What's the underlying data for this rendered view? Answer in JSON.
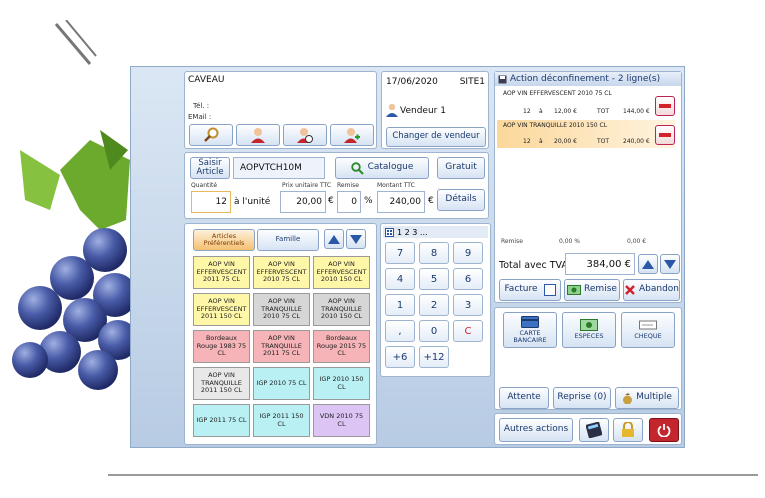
{
  "customer": {
    "name": "CAVEAU",
    "tel_label": "Tél. :",
    "email_label": "EMail :"
  },
  "session": {
    "date": "17/06/2020",
    "site": "SITE1",
    "vendor": "Vendeur 1",
    "change_vendor": "Changer de vendeur"
  },
  "article": {
    "saisir_label": "Saisir Article",
    "code": "AOPVTCH10M",
    "catalogue": "Catalogue",
    "gratuit": "Gratuit",
    "details": "Détails",
    "qty_label": "Quantité",
    "qty": "12",
    "unit": "à l'unité",
    "price_label": "Prix unitaire TTC",
    "price": "20,00",
    "currency": "€",
    "discount_label": "Remise",
    "discount": "0",
    "percent": "%",
    "amount_label": "Montant TTC",
    "amount": "240,00"
  },
  "browser": {
    "tab_favorites": "Articles Préférentiels",
    "tab_family": "Famille",
    "items": [
      {
        "label": "AOP VIN EFFERVESCENT 2011 75 CL",
        "color": "#fff7a8"
      },
      {
        "label": "AOP VIN EFFERVESCENT 2010 75 CL",
        "color": "#fff7a8"
      },
      {
        "label": "AOP VIN EFFERVESCENT 2010 150 CL",
        "color": "#fff7a8"
      },
      {
        "label": "AOP VIN EFFERVESCENT 2011 150 CL",
        "color": "#fff7a8"
      },
      {
        "label": "AOP VIN TRANQUILLE 2010 75 CL",
        "color": "#d6d6d6"
      },
      {
        "label": "AOP VIN TRANQUILLE 2010 150 CL",
        "color": "#d6d6d6"
      },
      {
        "label": "Bordeaux Rouge 1983 75 CL",
        "color": "#f6b4b8"
      },
      {
        "label": "AOP VIN TRANQUILLE 2011 75 CL",
        "color": "#f6b4b8"
      },
      {
        "label": "Bordeaux Rouge 2015 75 CL",
        "color": "#f6b4b8"
      },
      {
        "label": "AOP VIN TRANQUILLE 2011 150 CL",
        "color": "#e8e8e8"
      },
      {
        "label": "IGP 2010 75 CL",
        "color": "#b8f0f4"
      },
      {
        "label": "IGP 2010 150 CL",
        "color": "#b8f0f4"
      },
      {
        "label": "IGP 2011 75 CL",
        "color": "#b8f0f4"
      },
      {
        "label": "IGP 2011 150 CL",
        "color": "#b8f0f4"
      },
      {
        "label": "VDN 2010 75 CL",
        "color": "#dcc4f4"
      }
    ]
  },
  "keypad": {
    "display": "1 2 3 ...",
    "keys": [
      "7",
      "8",
      "9",
      "4",
      "5",
      "6",
      "1",
      "2",
      "3",
      ",",
      "0",
      "C",
      "+6",
      "+12"
    ]
  },
  "ticket": {
    "title": "Action déconfinement - 2 ligne(s)",
    "lines": [
      {
        "name": "AOP VIN EFFERVESCENT 2010 75 CL",
        "qty": "12",
        "at": "à",
        "price": "12,00 €",
        "tot_label": "TOT",
        "total": "144,00 €"
      },
      {
        "name": "AOP VIN TRANQUILLE 2010 150 CL",
        "qty": "12",
        "at": "à",
        "price": "20,00 €",
        "tot_label": "TOT",
        "total": "240,00 €"
      }
    ],
    "remise_label": "Remise",
    "remise_pct": "0,00 %",
    "remise_amount": "0,00 €",
    "total_label": "Total avec TVA",
    "total": "384,00 €",
    "facture": "Facture",
    "remise_btn": "Remise",
    "abandon": "Abandon"
  },
  "payment": {
    "card": "CARTE BANCAIRE",
    "cash": "ESPECES",
    "cheque": "CHEQUE"
  },
  "actions": {
    "attente": "Attente",
    "reprise": "Reprise (0)",
    "multiple": "Multiple",
    "autres": "Autres actions"
  },
  "colors": {
    "accent": "#1c3a6e",
    "delete": "#d4222a",
    "selected_row": "#fbd79a"
  }
}
